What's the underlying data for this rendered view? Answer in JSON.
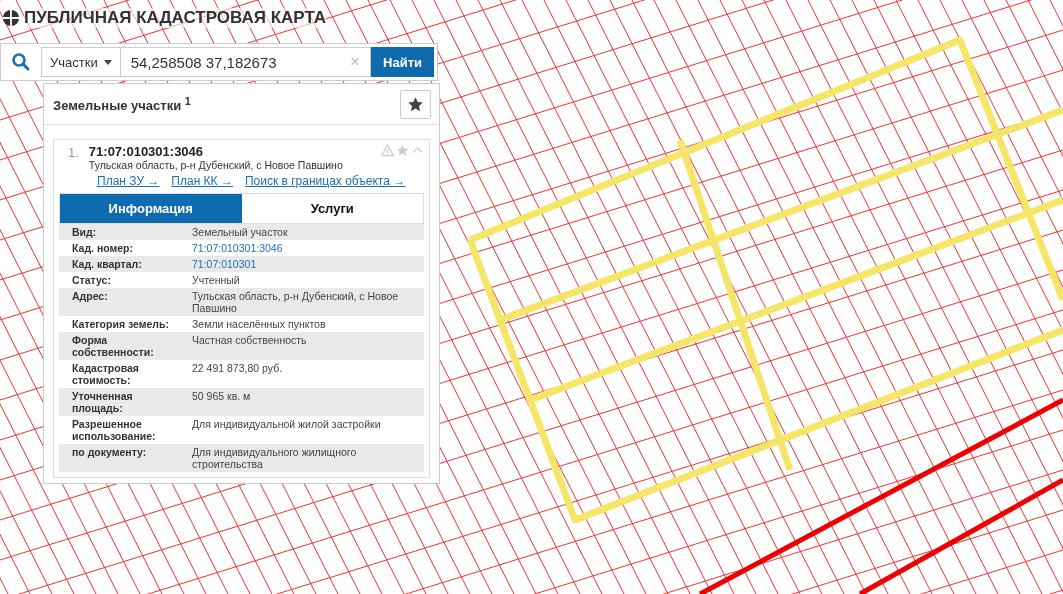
{
  "header": {
    "title": "ПУБЛИЧНАЯ КАДАСТРОВАЯ КАРТА"
  },
  "search": {
    "category": "Участки",
    "value": "54,258508 37,182673",
    "clear": "×",
    "button": "Найти"
  },
  "results": {
    "title": "Земельные участки",
    "count": "1",
    "items": [
      {
        "index": "1.",
        "number": "71:07:010301:3046",
        "address": "Тульская область, р-н Дубенский, с Новое Павшино",
        "links": [
          "План ЗУ →",
          "План КК →",
          "Поиск в границах объекта →"
        ],
        "tabs": [
          {
            "label": "Информация",
            "selected": true
          },
          {
            "label": "Услуги",
            "selected": false
          }
        ],
        "rows": [
          {
            "label": "Вид:",
            "value": "Земельный участок",
            "kind": "text"
          },
          {
            "label": "Кад. номер:",
            "value": "71:07:010301:3046",
            "kind": "link"
          },
          {
            "label": "Кад. квартал:",
            "value": "71:07:010301",
            "kind": "link"
          },
          {
            "label": "Статус:",
            "value": "Учтенный",
            "kind": "text"
          },
          {
            "label": "Адрес:",
            "value": "Тульская область, р-н Дубенский, с Новое Павшино",
            "kind": "text"
          },
          {
            "label": "Категория земель:",
            "value": "Земли населённых пунктов",
            "kind": "text"
          },
          {
            "label": "Форма собственности:",
            "value": "Частная собственность",
            "kind": "text"
          },
          {
            "label": "Кадастровая стоимость:",
            "value": "22 491 873,80 руб.",
            "kind": "text"
          },
          {
            "label": "Уточненная площадь:",
            "value": "50 965 кв. м",
            "kind": "text"
          },
          {
            "label": "Разрешенное использование:",
            "value": "Для индивидуальной жилой застройки",
            "kind": "text"
          },
          {
            "label": "по документу:",
            "value": "Для индивидуального жилищного строительства",
            "kind": "text"
          }
        ]
      }
    ]
  }
}
